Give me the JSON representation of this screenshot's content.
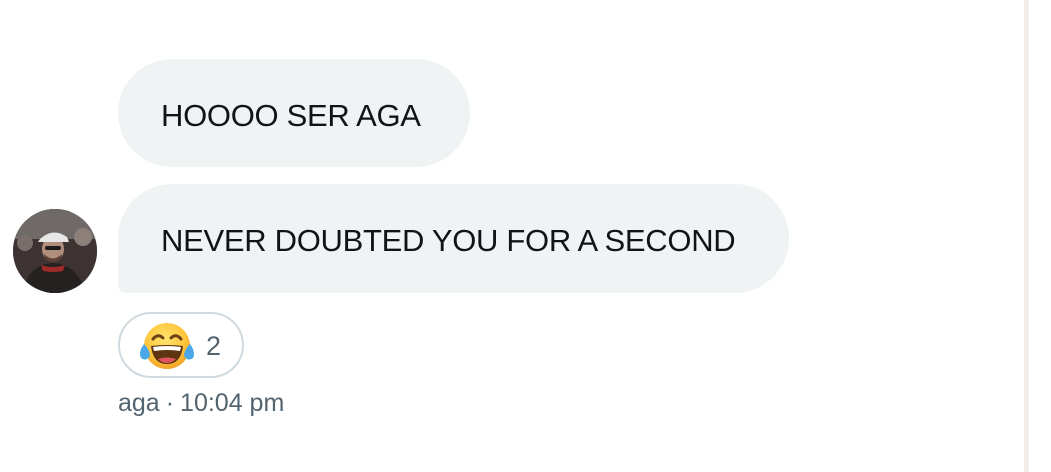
{
  "messages": [
    {
      "text": "HOOOO SER AGA"
    },
    {
      "text": "NEVER DOUBTED YOU FOR A SECOND"
    }
  ],
  "sender": {
    "avatar_icon": "user-avatar-photo"
  },
  "reaction": {
    "emoji": "face-with-tears-of-joy",
    "count": "2"
  },
  "meta": {
    "sender_name": "aga",
    "separator": "·",
    "time": "10:04 pm"
  },
  "colors": {
    "bubble_bg": "#eff3f4",
    "text": "#0f1419",
    "meta_text": "#536471",
    "reaction_border": "#cfd9de"
  }
}
